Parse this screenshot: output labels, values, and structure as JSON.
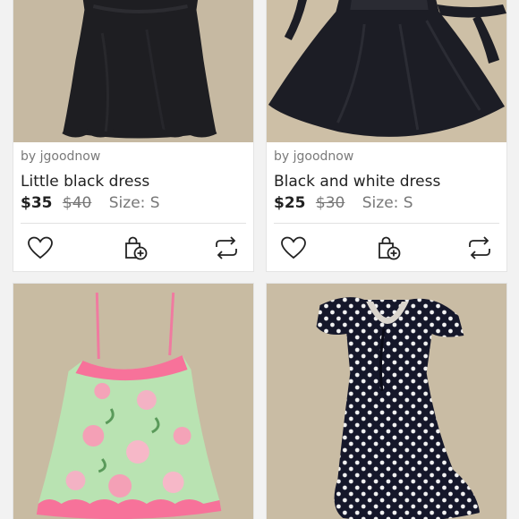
{
  "listings": [
    {
      "seller": "by jgoodnow",
      "title": "Little black dress",
      "price": "$35",
      "original_price": "$40",
      "size": "Size: S",
      "actions": [
        "heart-icon",
        "bundle-bag-icon",
        "share-icon"
      ]
    },
    {
      "seller": "by jgoodnow",
      "title": "Black and white dress",
      "price": "$25",
      "original_price": "$30",
      "size": "Size: S",
      "actions": [
        "heart-icon",
        "bundle-bag-icon",
        "share-icon"
      ]
    },
    {
      "photo": "green floral slip dress with pink lace trim"
    },
    {
      "photo": "navy polka dot wrap dress"
    }
  ],
  "colors": {
    "carpet": "#cbbfa8",
    "card_background": "#ffffff",
    "divider": "#e2e2e2",
    "text_primary": "#222222",
    "text_secondary": "#7a7a7a"
  }
}
